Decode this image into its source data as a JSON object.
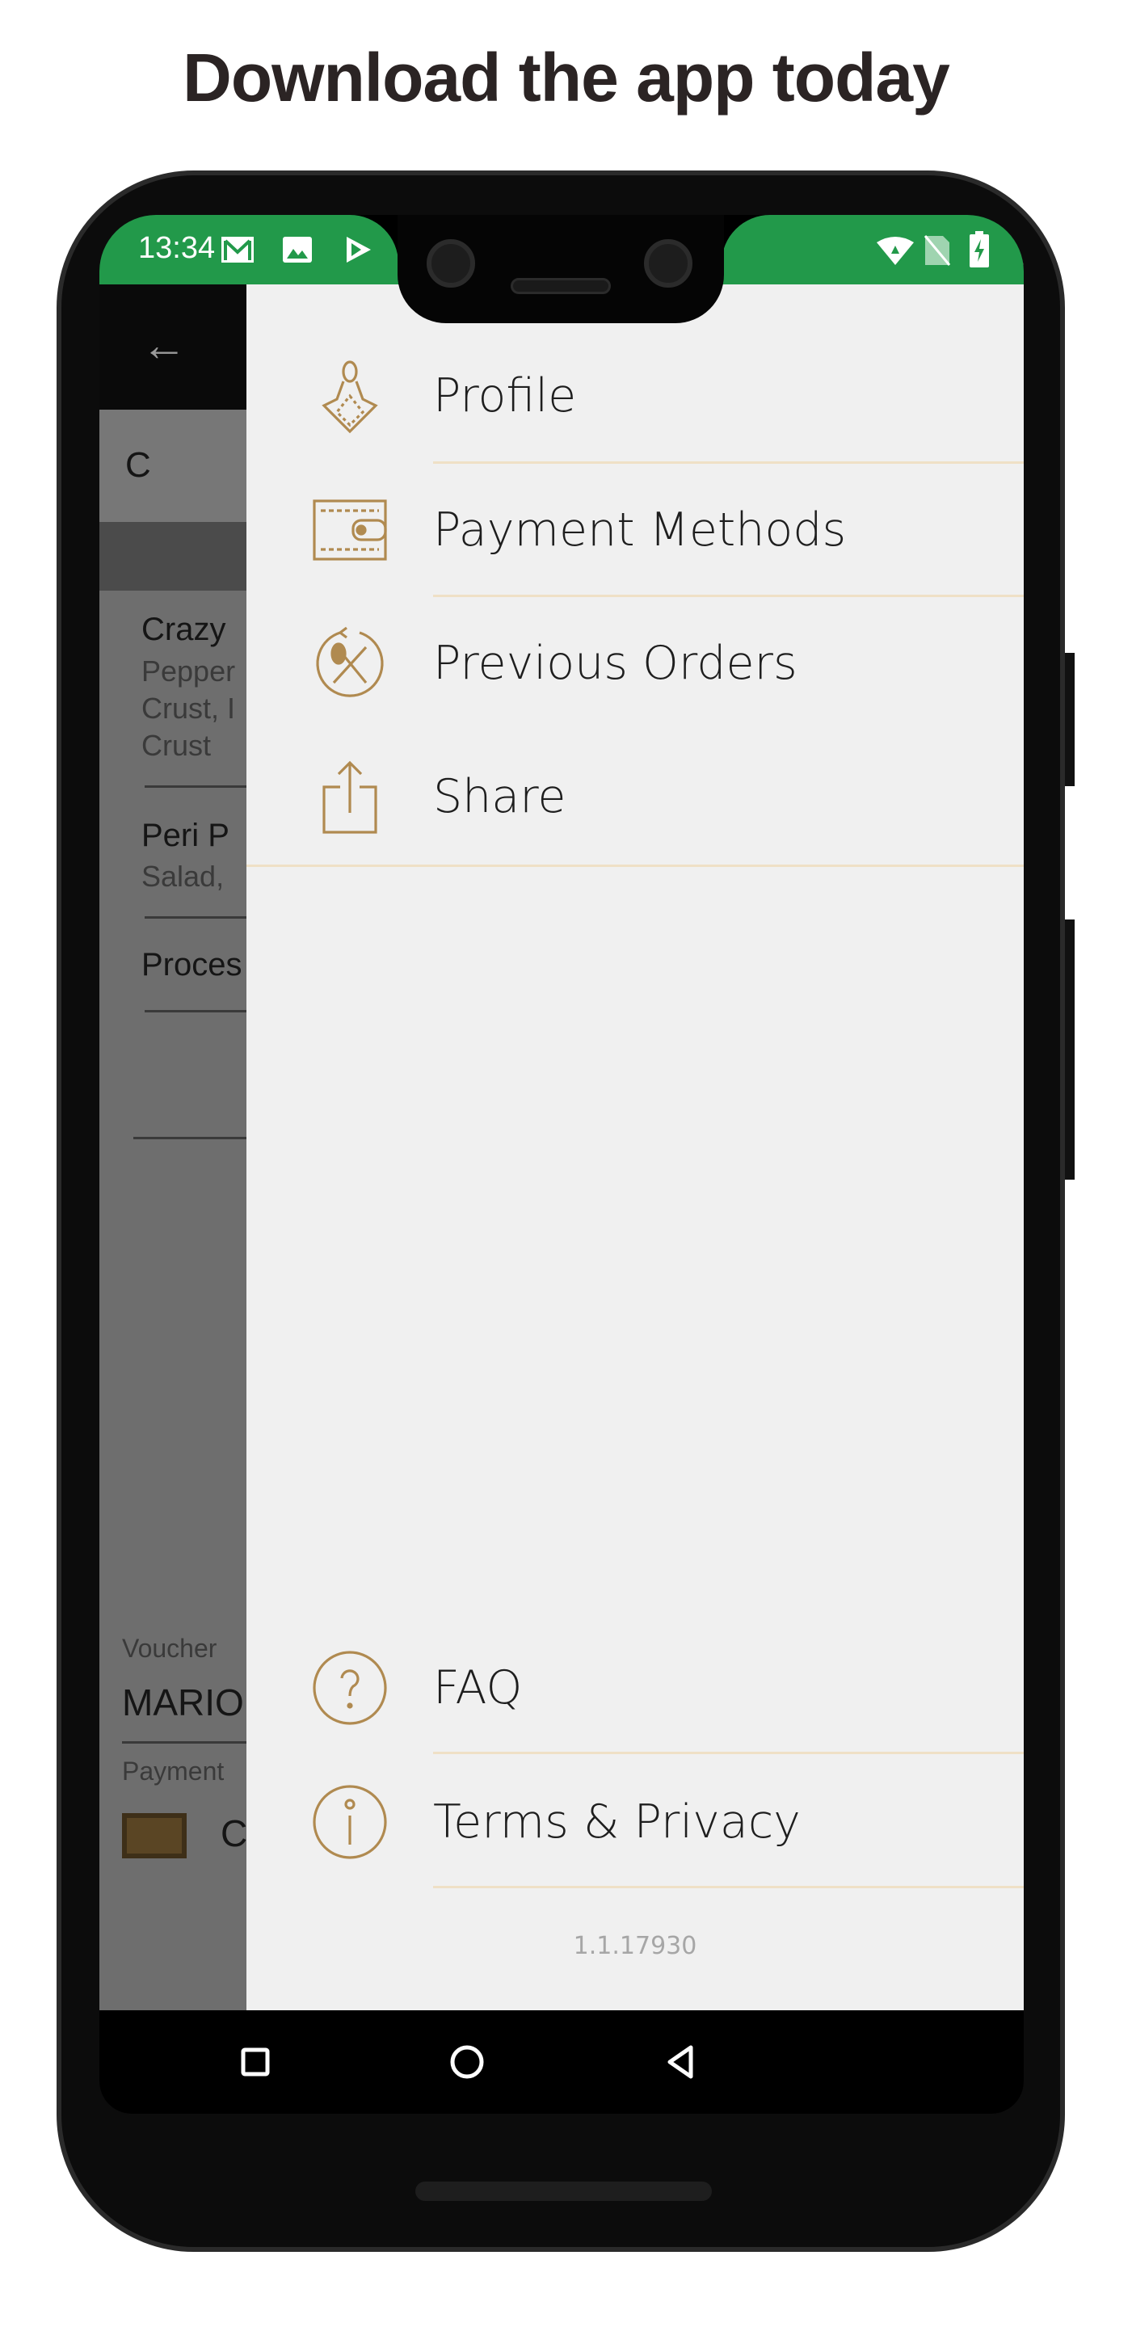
{
  "headline": "Download the app today",
  "status_bar": {
    "time": "13:34",
    "icons_left": [
      "gmail-icon",
      "image-icon",
      "play-store-icon"
    ],
    "icons_right": [
      "wifi-icon",
      "no-sim-icon",
      "battery-charging-icon"
    ],
    "color": "#22994a"
  },
  "background_app": {
    "tab_partial": "C",
    "items": [
      {
        "title": "Crazy",
        "lines": [
          "Pepper",
          "Crust, I",
          "Crust"
        ]
      },
      {
        "title": "Peri P",
        "lines": [
          "Salad,"
        ]
      },
      {
        "title": "Proces",
        "lines": []
      }
    ],
    "voucher_label": "Voucher",
    "voucher_value": "MARIO",
    "payment_label": "Payment",
    "payment_value": "C"
  },
  "drawer": {
    "accent": "#b08a50",
    "items": [
      {
        "label": "Profile",
        "icon": "profile-icon"
      },
      {
        "label": "Payment Methods",
        "icon": "wallet-icon"
      },
      {
        "label": "Previous Orders",
        "icon": "previous-orders-icon"
      },
      {
        "label": "Share",
        "icon": "share-icon"
      }
    ],
    "bottom_items": [
      {
        "label": "FAQ",
        "icon": "question-icon"
      },
      {
        "label": "Terms & Privacy",
        "icon": "info-icon"
      }
    ],
    "version": "1.1.17930"
  }
}
